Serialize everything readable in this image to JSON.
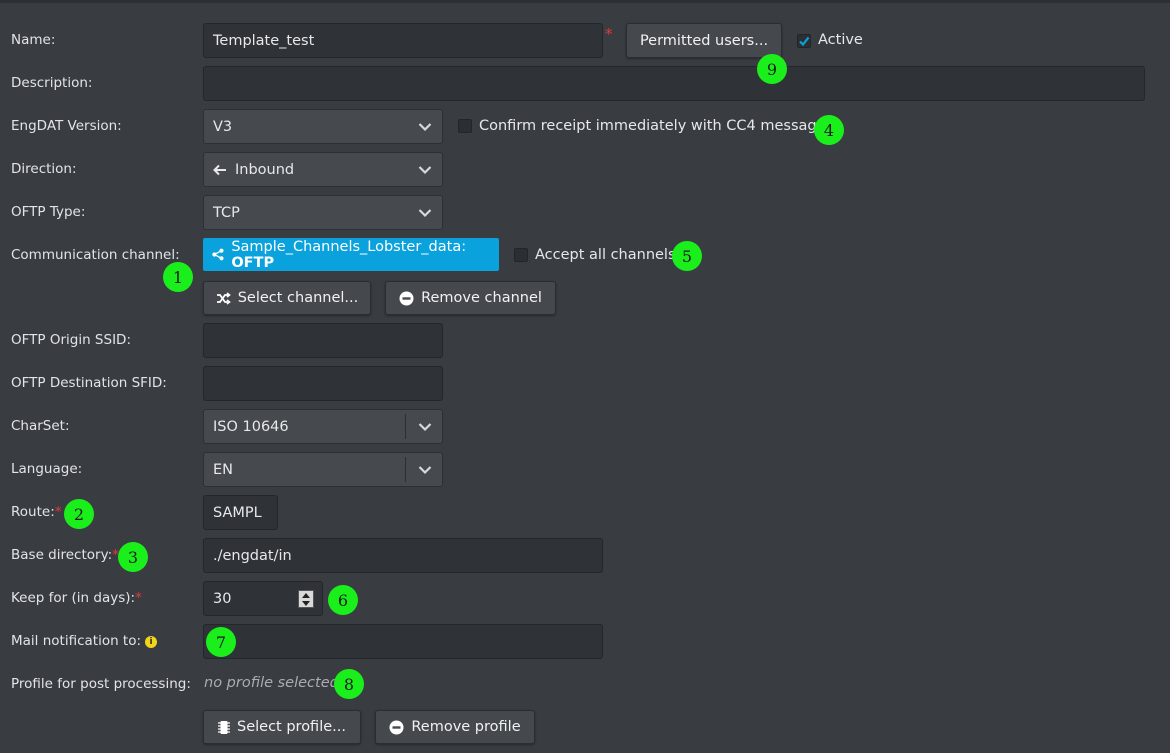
{
  "form": {
    "name": {
      "label": "Name:",
      "value": "Template_test",
      "required_mark": "*"
    },
    "permitted_users_button": "Permitted users...",
    "active": {
      "label": "Active",
      "checked": true
    },
    "description": {
      "label": "Description:",
      "value": ""
    },
    "engdat_version": {
      "label": "EngDAT Version:",
      "value": "V3"
    },
    "confirm_cc4": {
      "label": "Confirm receipt immediately with CC4 message",
      "checked": false
    },
    "direction": {
      "label": "Direction:",
      "value": "Inbound",
      "icon": "arrow-left-icon"
    },
    "oftp_type": {
      "label": "OFTP Type:",
      "value": "TCP"
    },
    "communication_channel": {
      "label": "Communication channel:",
      "chip_name": "Sample_Channels_Lobster_data:",
      "chip_type": "OFTP",
      "icon": "share-icon"
    },
    "accept_all_channels": {
      "label": "Accept all channels",
      "checked": false
    },
    "select_channel_button": "Select channel...",
    "remove_channel_button": "Remove channel",
    "oftp_origin_ssid": {
      "label": "OFTP Origin SSID:",
      "value": ""
    },
    "oftp_destination_sfid": {
      "label": "OFTP Destination SFID:",
      "value": ""
    },
    "charset": {
      "label": "CharSet:",
      "value": "ISO 10646"
    },
    "language": {
      "label": "Language:",
      "value": "EN"
    },
    "route": {
      "label": "Route:",
      "required_mark": "*",
      "value": "SAMPL"
    },
    "base_directory": {
      "label": "Base directory:",
      "required_mark": "*",
      "value": "./engdat/in"
    },
    "keep_for": {
      "label": "Keep for (in days):",
      "required_mark": "*",
      "value": "30"
    },
    "mail_notification": {
      "label": "Mail notification to:",
      "value": "",
      "info_icon": "i"
    },
    "profile_post_processing": {
      "label": "Profile for post processing:",
      "value": "no profile selected"
    },
    "select_profile_button": "Select profile...",
    "remove_profile_button": "Remove profile"
  },
  "annotations": [
    "1",
    "2",
    "3",
    "4",
    "5",
    "6",
    "7",
    "8",
    "9"
  ],
  "colors": {
    "background": "#393d42",
    "accent": "#0aa2dc",
    "annotation": "#1bef1b",
    "required": "#e5383b"
  }
}
